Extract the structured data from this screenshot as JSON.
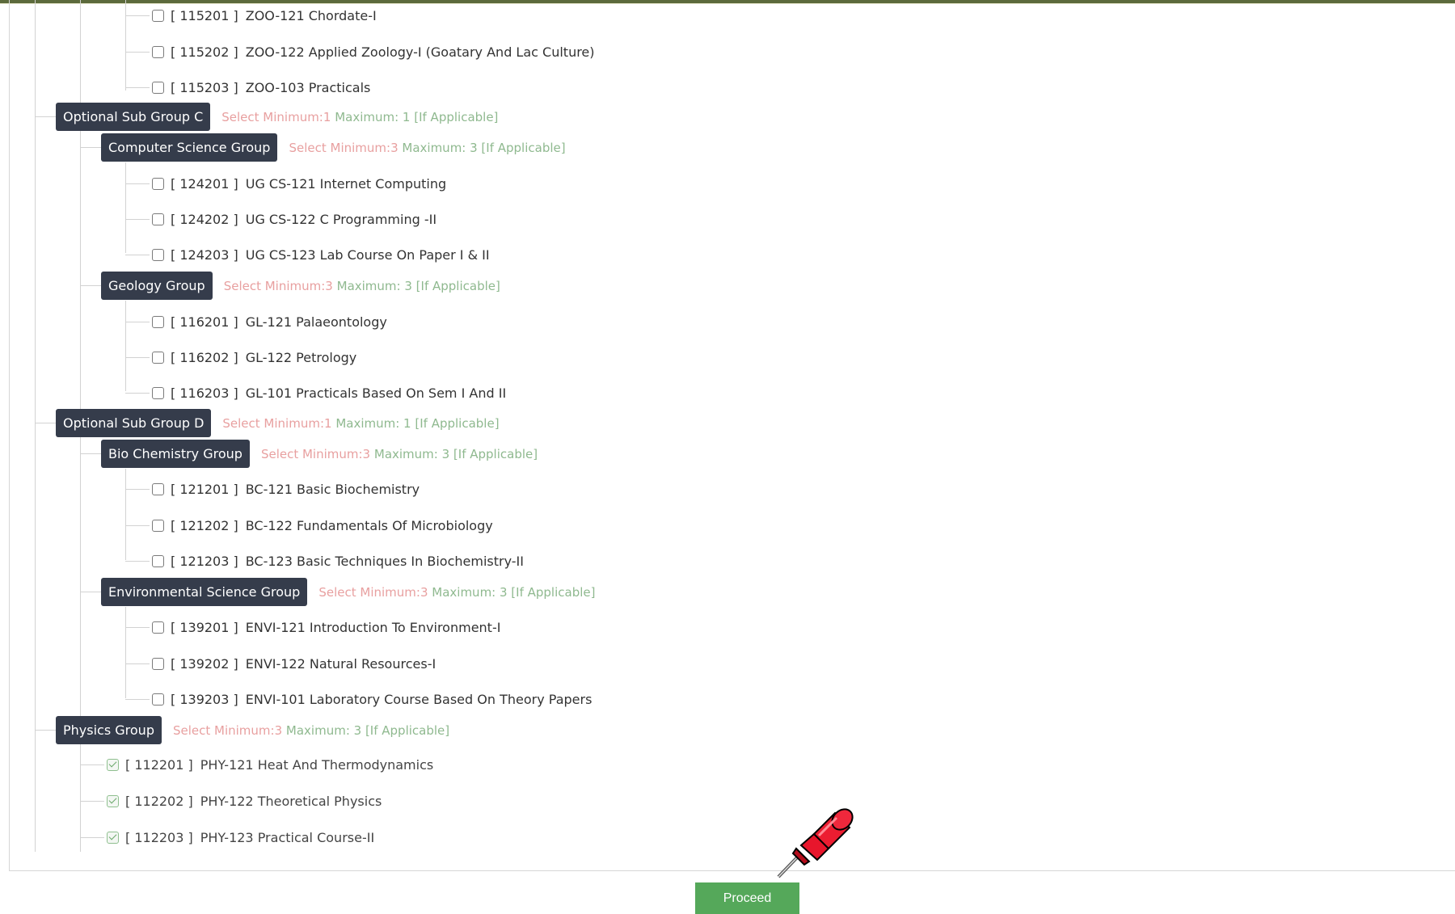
{
  "proceed_label": "Proceed",
  "colors": {
    "tag_bg": "#353c4b",
    "rule_min": "#e8a0a0",
    "rule_max": "#8fb98f",
    "proceed_bg": "#55a85a",
    "pin": "#e8162c"
  },
  "items": {
    "zoo_1": {
      "code": "[ 115201 ]",
      "label": "ZOO-121 Chordate-I"
    },
    "zoo_2": {
      "code": "[ 115202 ]",
      "label": "ZOO-122 Applied Zoology-I (Goatary And Lac Culture)"
    },
    "zoo_3": {
      "code": "[ 115203 ]",
      "label": "ZOO-103 Practicals"
    },
    "cs_1": {
      "code": "[ 124201 ]",
      "label": "UG CS-121 Internet Computing"
    },
    "cs_2": {
      "code": "[ 124202 ]",
      "label": "UG CS-122 C Programming -II"
    },
    "cs_3": {
      "code": "[ 124203 ]",
      "label": "UG CS-123 Lab Course On Paper I & II"
    },
    "gl_1": {
      "code": "[ 116201 ]",
      "label": "GL-121 Palaeontology"
    },
    "gl_2": {
      "code": "[ 116202 ]",
      "label": "GL-122 Petrology"
    },
    "gl_3": {
      "code": "[ 116203 ]",
      "label": "GL-101 Practicals Based On Sem I And II"
    },
    "bc_1": {
      "code": "[ 121201 ]",
      "label": "BC-121 Basic Biochemistry"
    },
    "bc_2": {
      "code": "[ 121202 ]",
      "label": "BC-122 Fundamentals Of Microbiology"
    },
    "bc_3": {
      "code": "[ 121203 ]",
      "label": "BC-123 Basic Techniques In Biochemistry-II"
    },
    "envi_1": {
      "code": "[ 139201 ]",
      "label": "ENVI-121 Introduction To Environment-I"
    },
    "envi_2": {
      "code": "[ 139202 ]",
      "label": "ENVI-122 Natural Resources-I"
    },
    "envi_3": {
      "code": "[ 139203 ]",
      "label": "ENVI-101 Laboratory Course Based On Theory Papers"
    },
    "phy_1": {
      "code": "[ 112201 ]",
      "label": "PHY-121 Heat And Thermodynamics",
      "checked": true
    },
    "phy_2": {
      "code": "[ 112202 ]",
      "label": "PHY-122 Theoretical Physics",
      "checked": true
    },
    "phy_3": {
      "code": "[ 112203 ]",
      "label": "PHY-123 Practical Course-II",
      "checked": true
    }
  },
  "groups": {
    "sub_c": {
      "name": "Optional Sub Group C",
      "min": "Select Minimum:1",
      "max": "Maximum: 1 [If Applicable]"
    },
    "cs": {
      "name": "Computer Science Group",
      "min": "Select Minimum:3",
      "max": "Maximum: 3 [If Applicable]"
    },
    "geo": {
      "name": "Geology Group",
      "min": "Select Minimum:3",
      "max": "Maximum: 3 [If Applicable]"
    },
    "sub_d": {
      "name": "Optional Sub Group D",
      "min": "Select Minimum:1",
      "max": "Maximum: 1 [If Applicable]"
    },
    "bio": {
      "name": "Bio Chemistry Group",
      "min": "Select Minimum:3",
      "max": "Maximum: 3 [If Applicable]"
    },
    "env": {
      "name": "Environmental Science Group",
      "min": "Select Minimum:3",
      "max": "Maximum: 3 [If Applicable]"
    },
    "phy": {
      "name": "Physics Group",
      "min": "Select Minimum:3",
      "max": "Maximum: 3 [If Applicable]"
    }
  }
}
